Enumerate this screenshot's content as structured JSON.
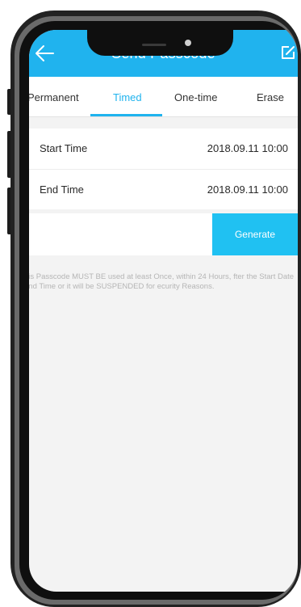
{
  "app": {
    "title": "Send Passcode",
    "back_icon": "arrow-left-icon",
    "edit_icon": "edit-icon"
  },
  "tabs": [
    {
      "label": "Permanent"
    },
    {
      "label": "Timed"
    },
    {
      "label": "One-time"
    },
    {
      "label": "Erase"
    }
  ],
  "form": {
    "start_label": "Start Time",
    "start_value": "2018.09.11 10:00",
    "end_label": "End Time",
    "end_value": "2018.09.11 10:00"
  },
  "generate_label": "Generate",
  "notice": "his Passcode MUST BE used at least Once, within 24 Hours, fter the Start Date and Time or it will be SUSPENDED for ecurity Reasons.",
  "colors": {
    "accent": "#20b3ee",
    "button": "#20c1f2",
    "background": "#f3f3f3",
    "notice_text": "#b5b5b5"
  }
}
